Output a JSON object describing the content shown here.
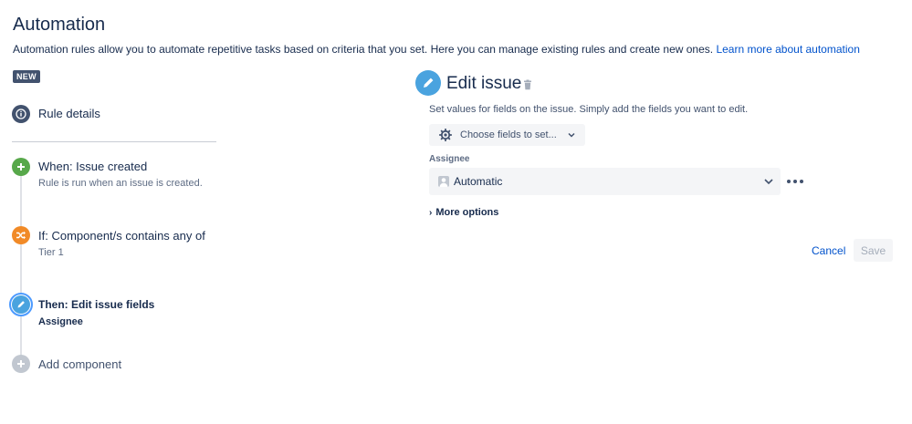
{
  "header": {
    "title": "Automation",
    "intro_text": "Automation rules allow you to automate repetitive tasks based on criteria that you set. Here you can manage existing rules and create new ones.",
    "learn_more_link": "Learn more about automation",
    "badge": "NEW"
  },
  "steps": {
    "rule_details": {
      "label": "Rule details",
      "icon": "info-icon"
    },
    "when": {
      "title": "When: Issue created",
      "subtitle": "Rule is run when an issue is created.",
      "icon": "plus-icon",
      "color": "#57a84a"
    },
    "if": {
      "title": "If: Component/s contains any of",
      "subtitle": "Tier 1",
      "icon": "shuffle-icon",
      "color": "#f18a27"
    },
    "then": {
      "title": "Then: Edit issue fields",
      "subtitle": "Assignee",
      "icon": "pencil-icon",
      "color": "#4aa3df"
    },
    "add": {
      "label": "Add component",
      "icon": "plus-icon",
      "color": "#c1c7d0"
    }
  },
  "editor": {
    "title": "Edit issue",
    "description": "Set values for fields on the issue. Simply add the fields you want to edit.",
    "choose_fields_label": "Choose fields to set...",
    "assignee_label": "Assignee",
    "assignee_value": "Automatic",
    "more_options_label": "More options",
    "cancel_label": "Cancel",
    "save_label": "Save"
  }
}
